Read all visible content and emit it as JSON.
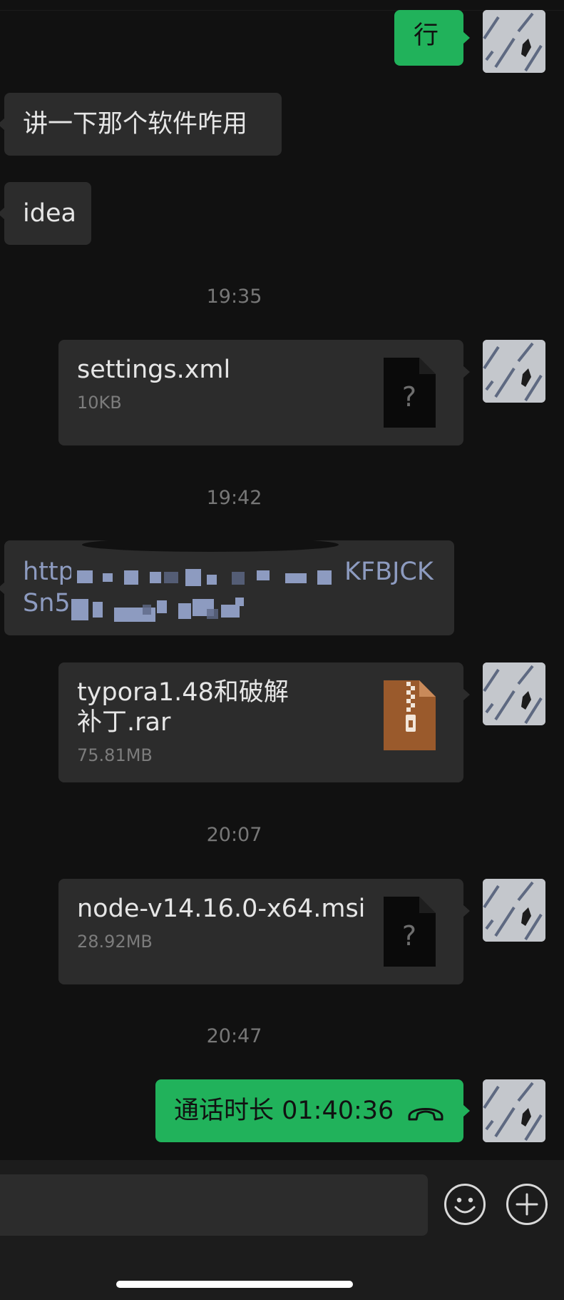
{
  "messages": {
    "m1": {
      "text": "行"
    },
    "m2": {
      "text": "讲一下那个软件咋用"
    },
    "m3": {
      "text": "idea"
    },
    "t1": "19:35",
    "file1": {
      "name": "settings.xml",
      "size": "10KB",
      "icon": "unknown-file-icon",
      "icon_glyph": "?"
    },
    "t2": "19:42",
    "link1": {
      "line1": "http",
      "line1_end": "KFBJCK",
      "line2": "Sn5"
    },
    "file2": {
      "name_line1": "typora1.48和破解",
      "name_line2": "补丁.rar",
      "size": "75.81MB",
      "icon": "zip-file-icon"
    },
    "t3": "20:07",
    "file3": {
      "name": "node-v14.16.0-x64.msi",
      "size": "28.92MB",
      "icon": "unknown-file-icon",
      "icon_glyph": "?"
    },
    "t4": "20:47",
    "call": {
      "text": "通话时长 01:40:36",
      "icon": "phone-hangup-icon"
    }
  },
  "input": {
    "placeholder": ""
  },
  "colors": {
    "background": "#111111",
    "bubble_dark": "#2c2c2c",
    "bubble_green": "#21b25b",
    "zip_icon": "#9a5a2c",
    "link": "#8d9bc0"
  }
}
